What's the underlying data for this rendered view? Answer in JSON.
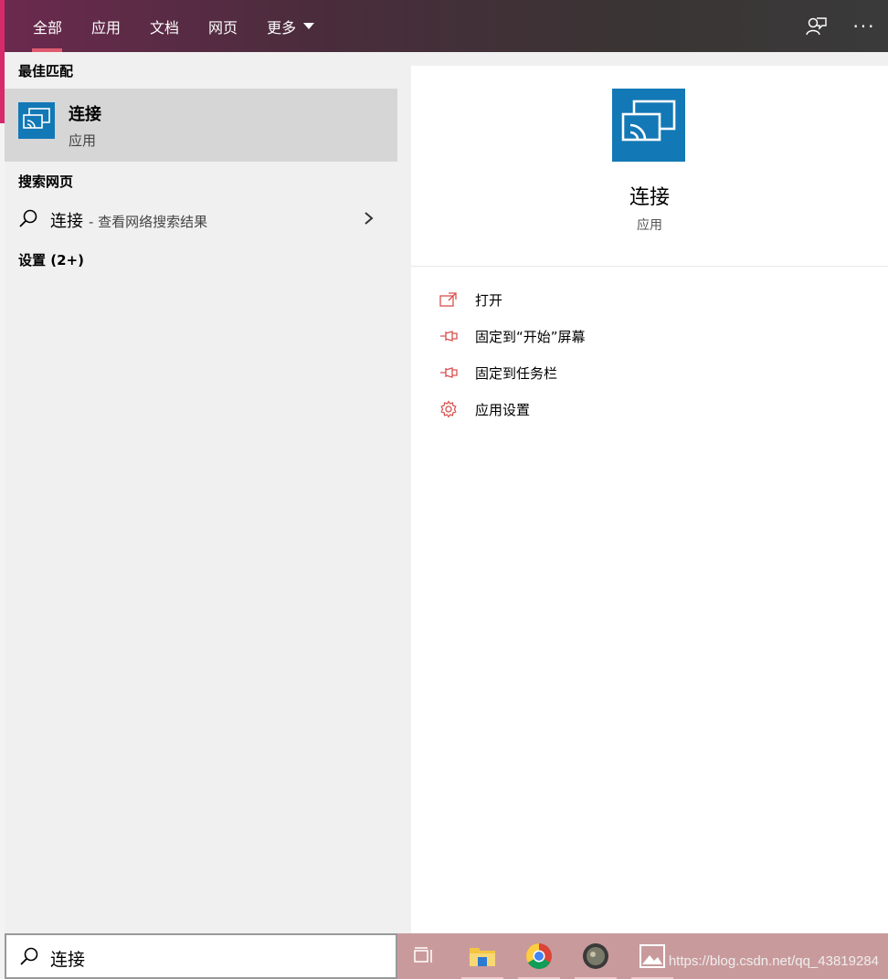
{
  "tabs": [
    {
      "label": "全部",
      "active": true
    },
    {
      "label": "应用"
    },
    {
      "label": "文档"
    },
    {
      "label": "网页"
    },
    {
      "label": "更多"
    }
  ],
  "tabbar": {
    "feedback_icon": "feedback-icon",
    "more_options": "···"
  },
  "best_match": {
    "header": "最佳匹配",
    "name": "连接",
    "type": "应用",
    "icon": "cast-icon"
  },
  "web_search": {
    "header": "搜索网页",
    "term": "连接",
    "hint": "- 查看网络搜索结果"
  },
  "settings": {
    "header": "设置 (2+)"
  },
  "detail": {
    "name": "连接",
    "type": "应用",
    "actions": [
      {
        "label": "打开",
        "icon": "open-icon"
      },
      {
        "label": "固定到“开始”屏幕",
        "icon": "pin-icon"
      },
      {
        "label": "固定到任务栏",
        "icon": "pin-icon"
      },
      {
        "label": "应用设置",
        "icon": "gear-icon"
      }
    ]
  },
  "search_box": {
    "value": "连接"
  },
  "taskbar": {
    "apps": [
      "task-view-icon",
      "file-explorer-icon",
      "chrome-icon",
      "app-icon",
      "photos-icon"
    ],
    "watermark": "https://blog.csdn.net/qq_43819284"
  },
  "colors": {
    "accent": "#1378b6",
    "action_icon": "#d9504f",
    "tab_underline": "#e05a6e"
  }
}
